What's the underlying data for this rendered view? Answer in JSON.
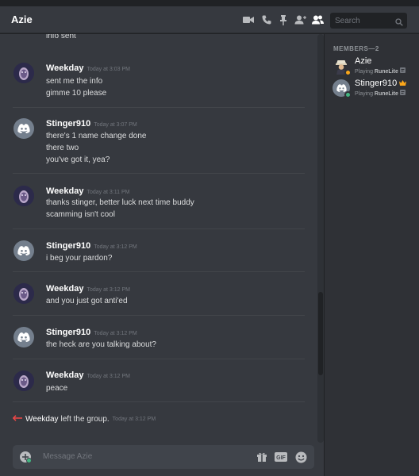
{
  "header": {
    "title": "Azie",
    "search_placeholder": "Search"
  },
  "messages": {
    "top_line": "info sent",
    "groups": [
      {
        "author": "Weekday",
        "timestamp": "Today at 3:03 PM",
        "lines": [
          "sent me the info",
          "gimme 10 please"
        ]
      },
      {
        "author": "Stinger910",
        "timestamp": "Today at 3:07 PM",
        "lines": [
          "there's 1 name change done",
          "there two",
          "you've got it, yea?"
        ]
      },
      {
        "author": "Weekday",
        "timestamp": "Today at 3:11 PM",
        "lines": [
          "thanks stinger, better luck next time buddy",
          "scamming isn't cool"
        ]
      },
      {
        "author": "Stinger910",
        "timestamp": "Today at 3:12 PM",
        "lines": [
          "i beg your pardon?"
        ]
      },
      {
        "author": "Weekday",
        "timestamp": "Today at 3:12 PM",
        "lines": [
          "and you just got anti'ed"
        ]
      },
      {
        "author": "Stinger910",
        "timestamp": "Today at 3:12 PM",
        "lines": [
          "the heck are you talking about?"
        ]
      },
      {
        "author": "Weekday",
        "timestamp": "Today at 3:12 PM",
        "lines": [
          "peace"
        ]
      }
    ],
    "system": {
      "who": "Weekday",
      "text": "left the group.",
      "timestamp": "Today at 3:12 PM"
    }
  },
  "composer": {
    "placeholder": "Message Azie"
  },
  "members": {
    "heading": "MEMBERS—2",
    "list": [
      {
        "name": "Azie",
        "playing_label": "Playing",
        "game": "RuneLite",
        "status_color": "#faa61a"
      },
      {
        "name": "Stinger910",
        "playing_label": "Playing",
        "game": "RuneLite",
        "status_color": "#43b581",
        "owner_crown": true
      }
    ]
  },
  "colors": {
    "background": "#36393f",
    "sidebar": "#2f3136",
    "leave_arrow": "#f04747",
    "crown": "#faa61a"
  }
}
